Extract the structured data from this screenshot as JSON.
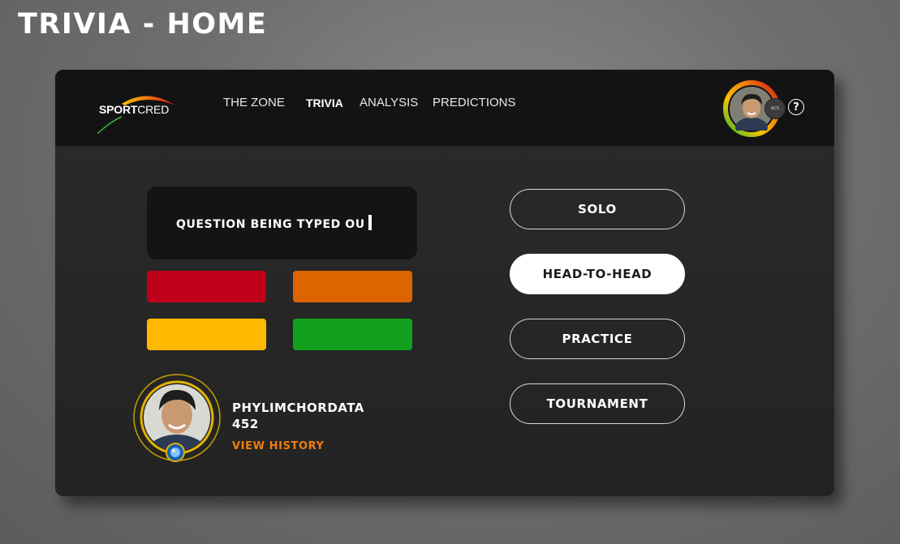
{
  "page": {
    "title": "TRIVIA - HOME"
  },
  "header": {
    "logo": {
      "brand_bold": "SPORT",
      "brand_light": "CRED"
    },
    "nav": [
      {
        "label": "THE ZONE",
        "active": false
      },
      {
        "label": "TRIVIA",
        "active": true
      },
      {
        "label": "ANALYSIS",
        "active": false
      },
      {
        "label": "PREDICTIONS",
        "active": false
      }
    ],
    "profile_badge": "ACS",
    "help_icon": "?"
  },
  "game": {
    "question": "QUESTION BEING TYPED OU",
    "answers": [
      {
        "color": "#c0001a"
      },
      {
        "color": "#dd6400"
      },
      {
        "color": "#ffb800"
      },
      {
        "color": "#12a11e"
      }
    ]
  },
  "profile": {
    "username": "PHYLIMCHORDATA",
    "score": "452",
    "view_history": "VIEW HISTORY"
  },
  "modes": {
    "solo": "SOLO",
    "head_to_head": "HEAD-TO-HEAD",
    "practice": "PRACTICE",
    "tournament": "TOURNAMENT",
    "selected": "HEAD-TO-HEAD"
  },
  "colors": {
    "accent_orange": "#f07d0c",
    "gold_ring": "#e0b400",
    "background": "#6f6f6f",
    "panel": "#262626",
    "navbar": "#131313"
  }
}
